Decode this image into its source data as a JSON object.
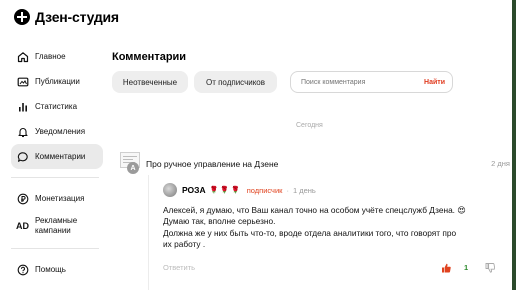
{
  "app": {
    "title": "Дзен-студия"
  },
  "sidebar": {
    "items": [
      {
        "label": "Главное",
        "icon": "home-icon"
      },
      {
        "label": "Публикации",
        "icon": "publications-icon"
      },
      {
        "label": "Статистика",
        "icon": "stats-icon"
      },
      {
        "label": "Уведомления",
        "icon": "bell-icon"
      },
      {
        "label": "Комментарии",
        "icon": "comments-icon",
        "active": true
      }
    ],
    "items2": [
      {
        "label": "Монетизация",
        "icon": "ruble-icon"
      },
      {
        "label": "Рекламные кампании",
        "icon": "ad-icon",
        "icon_text": "AD"
      }
    ],
    "items3": [
      {
        "label": "Помощь",
        "icon": "help-icon"
      }
    ]
  },
  "main": {
    "title": "Комментарии",
    "filters": [
      "Неотвеченные",
      "От подписчиков"
    ],
    "search": {
      "placeholder": "Поиск комментария",
      "button": "Найти"
    },
    "date_separator": "Сегодня",
    "article": {
      "title": "Про ручное управление на Дзене",
      "time": "2 дня",
      "badge": "A"
    },
    "comment": {
      "author": "РОЗА",
      "flowers": "🌹 🌹 🌹",
      "subscriber": "подписчик",
      "separator": "·",
      "time": "1 день",
      "lines": [
        "Алексей, я думаю, что Ваш канал точно на особом учёте  спецслужб Дзена. 😍",
        "Думаю так, вполне серьезно.",
        "Должна же у них быть что-то, вроде отдела аналитики  того, что  говорят про",
        "их работу ."
      ],
      "reply_label": "Ответить",
      "likes": "1"
    }
  },
  "colors": {
    "accent": "#e03a1e",
    "like_count": "#2e8b2e",
    "active_nav": "#eaeaea"
  }
}
